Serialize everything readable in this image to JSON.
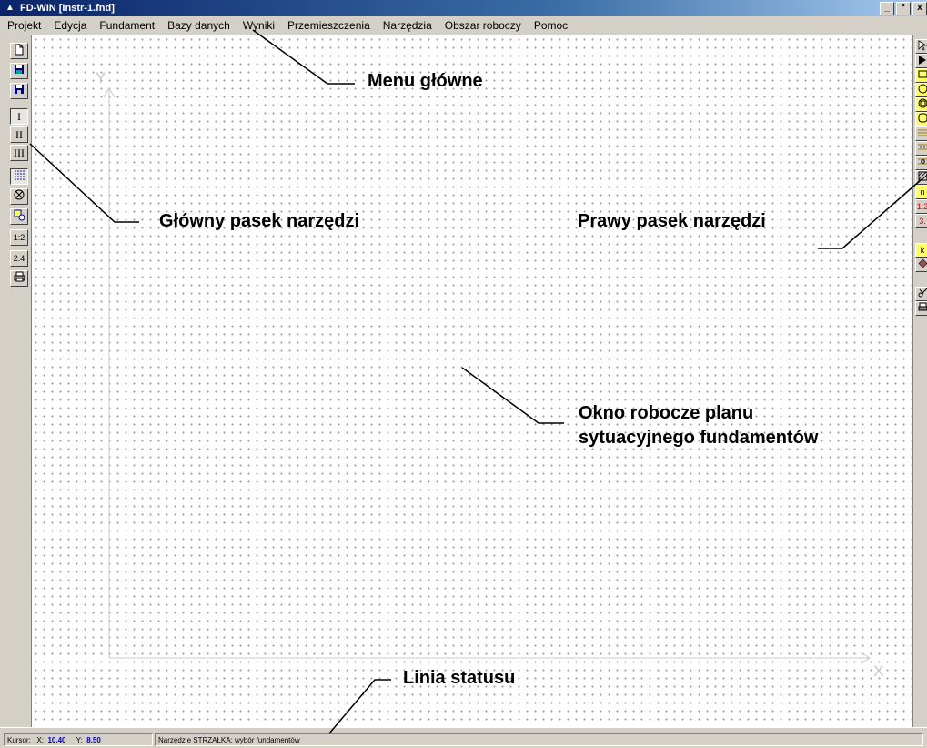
{
  "window": {
    "title": "FD-WIN [Instr-1.fnd]",
    "buttons": {
      "minimize": "_",
      "maximize": "°",
      "close": "x"
    }
  },
  "menu": [
    "Projekt",
    "Edycja",
    "Fundament",
    "Bazy danych",
    "Wyniki",
    "Przemieszczenia",
    "Narzędzia",
    "Obszar roboczy",
    "Pomoc"
  ],
  "left_toolbar": [
    "I",
    "II",
    "III",
    "1:2",
    "2.4"
  ],
  "right_toolbar": [
    "n",
    "1.2",
    "3.",
    "k"
  ],
  "axes": {
    "y": "Y",
    "x": "X"
  },
  "statusbar": {
    "cursor_label": "Kursor:",
    "x_label": "X:",
    "x_value": "10.40",
    "y_label": "Y:",
    "y_value": "8.50",
    "tool_text": "Narzędzie STRZAŁKA: wybór fundamentów"
  },
  "annotations": {
    "menu": "Menu główne",
    "left_toolbar": "Główny pasek narzędzi",
    "right_toolbar": "Prawy pasek narzędzi",
    "workspace_line1": "Okno robocze planu",
    "workspace_line2": "sytuacyjnego fundamentów",
    "statusbar": "Linia statusu"
  },
  "colors": {
    "titlebar": "#0a246a",
    "chrome": "#d4d0c8",
    "axis": "#c8c8c8",
    "status_value": "#0000aa"
  }
}
